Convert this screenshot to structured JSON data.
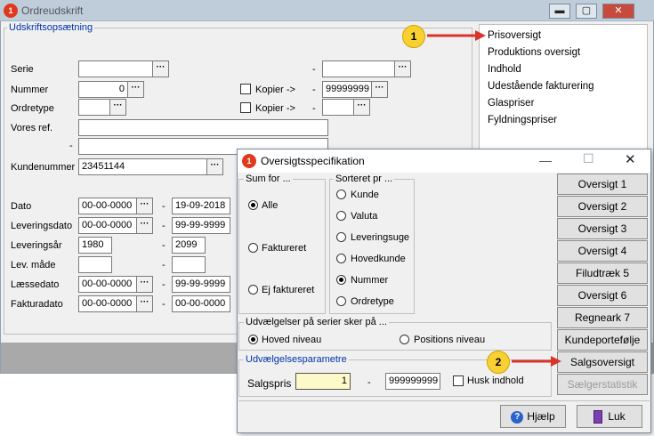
{
  "main_window": {
    "title": "Ordreudskrift",
    "group_label": "Udskriftsopsætning",
    "labels": {
      "serie": "Serie",
      "nummer": "Nummer",
      "ordretype": "Ordretype",
      "vores_ref": "Vores ref.",
      "kundenummer": "Kundenummer",
      "dato": "Dato",
      "leveringsdato": "Leveringsdato",
      "leveringsaar": "Leveringsår",
      "lev_maade": "Lev. måde",
      "laessedato": "Læssedato",
      "fakturadato": "Fakturadato"
    },
    "dash": "-",
    "kopier_label": "Kopier ->",
    "values": {
      "nummer_from": "0",
      "nummer_to": "99999999",
      "kundenummer": "23451144",
      "dato_from": "00-00-0000",
      "dato_to": "19-09-2018",
      "leveringsdato_from": "00-00-0000",
      "leveringsdato_to": "99-99-9999",
      "leveringsaar_from": "1980",
      "leveringsaar_to": "2099",
      "laessedato_from": "00-00-0000",
      "laessedato_to": "99-99-9999",
      "fakturadato_from": "00-00-0000",
      "fakturadato_to": "00-00-0000"
    },
    "menu": [
      "Prisoversigt",
      "Produktions oversigt",
      "Indhold",
      "Udestående fakturering",
      "Glaspriser",
      "Fyldningspriser"
    ]
  },
  "dialog": {
    "title": "Oversigtsspecifikation",
    "sum_for": {
      "label": "Sum for ...",
      "options": [
        "Alle",
        "Faktureret",
        "Ej faktureret"
      ],
      "selected": "Alle"
    },
    "sorteret": {
      "label": "Sorteret pr ...",
      "options": [
        "Kunde",
        "Valuta",
        "Leveringsuge",
        "Hovedkunde",
        "Nummer",
        "Ordretype"
      ],
      "selected": "Nummer"
    },
    "udvaelgelser": {
      "label": "Udvælgelser på serier sker på ...",
      "options": [
        "Hoved niveau",
        "Positions niveau"
      ],
      "selected": "Hoved niveau"
    },
    "param": {
      "label": "Udvælgelsesparametre",
      "salgspris_label": "Salgspris",
      "from": "1",
      "to": "999999999",
      "dash": "-",
      "husk": "Husk indhold"
    },
    "buttons": [
      "Oversigt 1",
      "Oversigt 2",
      "Oversigt 3",
      "Oversigt 4",
      "Filudtræk 5",
      "Oversigt 6",
      "Regneark 7",
      "Kundeportefølje",
      "Salgsoversigt",
      "Sælgerstatistik"
    ],
    "help_label": "Hjælp",
    "close_label": "Luk"
  },
  "callouts": [
    "1",
    "2"
  ],
  "colors": {
    "callout": "#f8d032",
    "arrow": "#d9342b",
    "group_label": "#0033aa",
    "titlebar": "#bfcddb"
  }
}
